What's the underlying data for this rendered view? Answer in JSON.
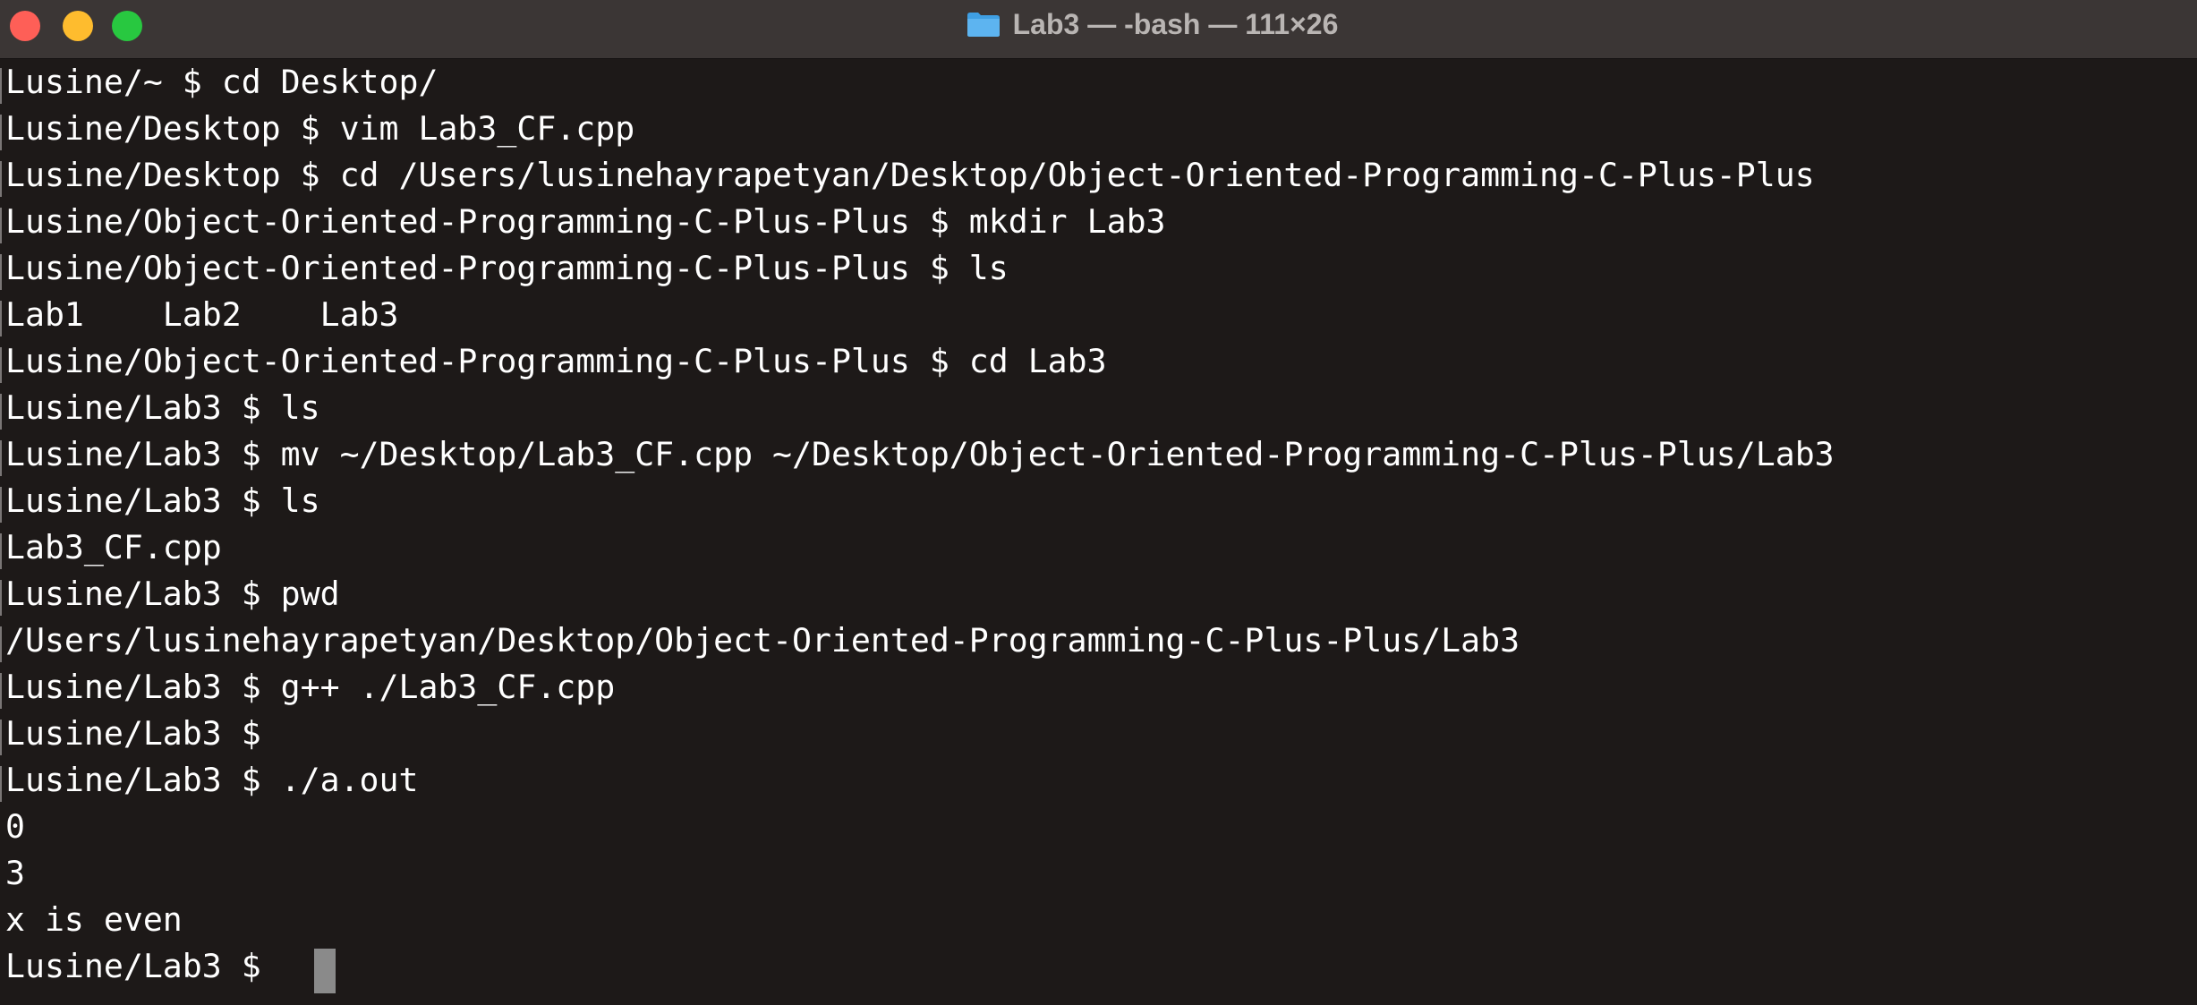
{
  "window": {
    "title": "Lab3 — -bash — 111×26",
    "folder_icon": "folder-icon",
    "colors": {
      "background": "#1d1918",
      "titlebar": "#3b3635",
      "text": "#ffffff",
      "close": "#fe5f57",
      "minimize": "#febc2e",
      "maximize": "#28c840"
    }
  },
  "terminal": {
    "lines": [
      "Lusine/~ $ cd Desktop/",
      "Lusine/Desktop $ vim Lab3_CF.cpp",
      "Lusine/Desktop $ cd /Users/lusinehayrapetyan/Desktop/Object-Oriented-Programming-C-Plus-Plus",
      "Lusine/Object-Oriented-Programming-C-Plus-Plus $ mkdir Lab3",
      "Lusine/Object-Oriented-Programming-C-Plus-Plus $ ls",
      "Lab1    Lab2    Lab3",
      "Lusine/Object-Oriented-Programming-C-Plus-Plus $ cd Lab3",
      "Lusine/Lab3 $ ls",
      "Lusine/Lab3 $ mv ~/Desktop/Lab3_CF.cpp ~/Desktop/Object-Oriented-Programming-C-Plus-Plus/Lab3",
      "Lusine/Lab3 $ ls",
      "Lab3_CF.cpp",
      "Lusine/Lab3 $ pwd",
      "/Users/lusinehayrapetyan/Desktop/Object-Oriented-Programming-C-Plus-Plus/Lab3",
      "Lusine/Lab3 $ g++ ./Lab3_CF.cpp",
      "Lusine/Lab3 $",
      "Lusine/Lab3 $ ./a.out",
      "0",
      "3",
      "x is even",
      "Lusine/Lab3 $ "
    ]
  }
}
